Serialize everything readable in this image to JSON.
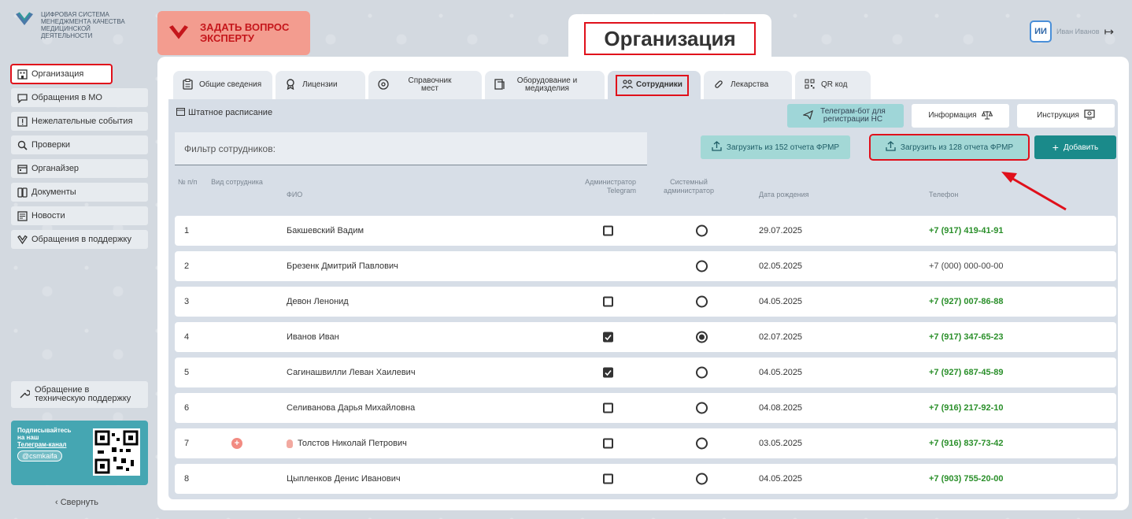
{
  "colors": {
    "accent_red": "#e0101b",
    "teal": "#1a8a8a",
    "phone_green": "#2a8f2a"
  },
  "logo": {
    "text": "ЦИФРОВАЯ СИСТЕМА МЕНЕДЖМЕНТА КАЧЕСТВА МЕДИЦИНСКОЙ ДЕЯТЕЛЬНОСТИ"
  },
  "header": {
    "ask_expert": "ЗАДАТЬ ВОПРОС ЭКСПЕРТУ",
    "page_title": "Организация",
    "user_initials": "ИИ",
    "user_name": "Иван Иванов"
  },
  "sidebar": {
    "items": [
      {
        "label": "Организация",
        "icon": "building-icon"
      },
      {
        "label": "Обращения в МО",
        "icon": "chat-icon"
      },
      {
        "label": "Нежелательные события",
        "icon": "alert-icon"
      },
      {
        "label": "Проверки",
        "icon": "search-icon"
      },
      {
        "label": "Органайзер",
        "icon": "calendar-icon"
      },
      {
        "label": "Документы",
        "icon": "documents-icon"
      },
      {
        "label": "Новости",
        "icon": "news-icon"
      },
      {
        "label": "Обращения в поддержку",
        "icon": "heart-icon"
      }
    ],
    "tech_support": "Обращение в техническую поддержку",
    "telegram_card": {
      "line1": "Подписывайтесь на наш",
      "line2": "Телеграм-канал",
      "handle": "@csmkaifa"
    },
    "collapse": "Свернуть"
  },
  "tabs": [
    {
      "label": "Общие сведения",
      "icon": "clipboard-icon"
    },
    {
      "label": "Лицензии",
      "icon": "award-icon"
    },
    {
      "label": "Справочник мест",
      "icon": "location-icon"
    },
    {
      "label": "Оборудование и медизделия",
      "icon": "equipment-icon"
    },
    {
      "label": "Сотрудники",
      "icon": "people-icon",
      "active": true
    },
    {
      "label": "Лекарства",
      "icon": "pill-icon"
    },
    {
      "label": "QR код",
      "icon": "qr-icon"
    }
  ],
  "toolbar": {
    "staff_schedule": "Штатное расписание",
    "telegram_bot": "Телеграм-бот для регистрации НС",
    "info": "Информация",
    "instruction": "Инструкция",
    "filter_placeholder": "Фильтр сотрудников:",
    "load_152": "Загрузить из 152 отчета ФРМР",
    "load_128": "Загрузить из 128 отчета ФРМР",
    "add": "Добавить"
  },
  "table": {
    "headers": {
      "num": "№ п/п",
      "type": "Вид сотрудника",
      "fio": "ФИО",
      "tg_admin": "Администратор Telegram",
      "sys_admin": "Системный администратор",
      "dob": "Дата рождения",
      "phone": "Телефон"
    },
    "rows": [
      {
        "n": "1",
        "fio": "Бакшевский Вадим",
        "tg": false,
        "tg_shown": true,
        "sys": false,
        "dob": "29.07.2025",
        "phone": "+7 (917) 419-41-91",
        "phone_bold": true
      },
      {
        "n": "2",
        "fio": "Брезенк Дмитрий Павлович",
        "tg": false,
        "tg_shown": false,
        "sys": false,
        "dob": "02.05.2025",
        "phone": "+7 (000) 000-00-00",
        "phone_bold": false
      },
      {
        "n": "3",
        "fio": "Девон Ленонид",
        "tg": false,
        "tg_shown": true,
        "sys": false,
        "dob": "04.05.2025",
        "phone": "+7 (927) 007-86-88",
        "phone_bold": true
      },
      {
        "n": "4",
        "fio": "Иванов Иван",
        "tg": true,
        "tg_shown": true,
        "sys": true,
        "dob": "02.07.2025",
        "phone": "+7 (917) 347-65-23",
        "phone_bold": true
      },
      {
        "n": "5",
        "fio": "Сагинашвилли Леван Хаилевич",
        "tg": true,
        "tg_shown": true,
        "sys": false,
        "dob": "04.05.2025",
        "phone": "+7 (927) 687-45-89",
        "phone_bold": true
      },
      {
        "n": "6",
        "fio": "Селиванова Дарья Михайловна",
        "tg": false,
        "tg_shown": true,
        "sys": false,
        "dob": "04.08.2025",
        "phone": "+7 (916) 217-92-10",
        "phone_bold": true
      },
      {
        "n": "7",
        "fio": "Толстов Николай Петрович",
        "tg": false,
        "tg_shown": true,
        "sys": false,
        "dob": "03.05.2025",
        "phone": "+7 (916) 837-73-42",
        "phone_bold": true,
        "type_icon": "medical-cross-icon",
        "fio_icon": "hand-icon"
      },
      {
        "n": "8",
        "fio": "Цыпленков Денис Иванович",
        "tg": false,
        "tg_shown": true,
        "sys": false,
        "dob": "04.05.2025",
        "phone": "+7 (903) 755-20-00",
        "phone_bold": true
      }
    ]
  }
}
